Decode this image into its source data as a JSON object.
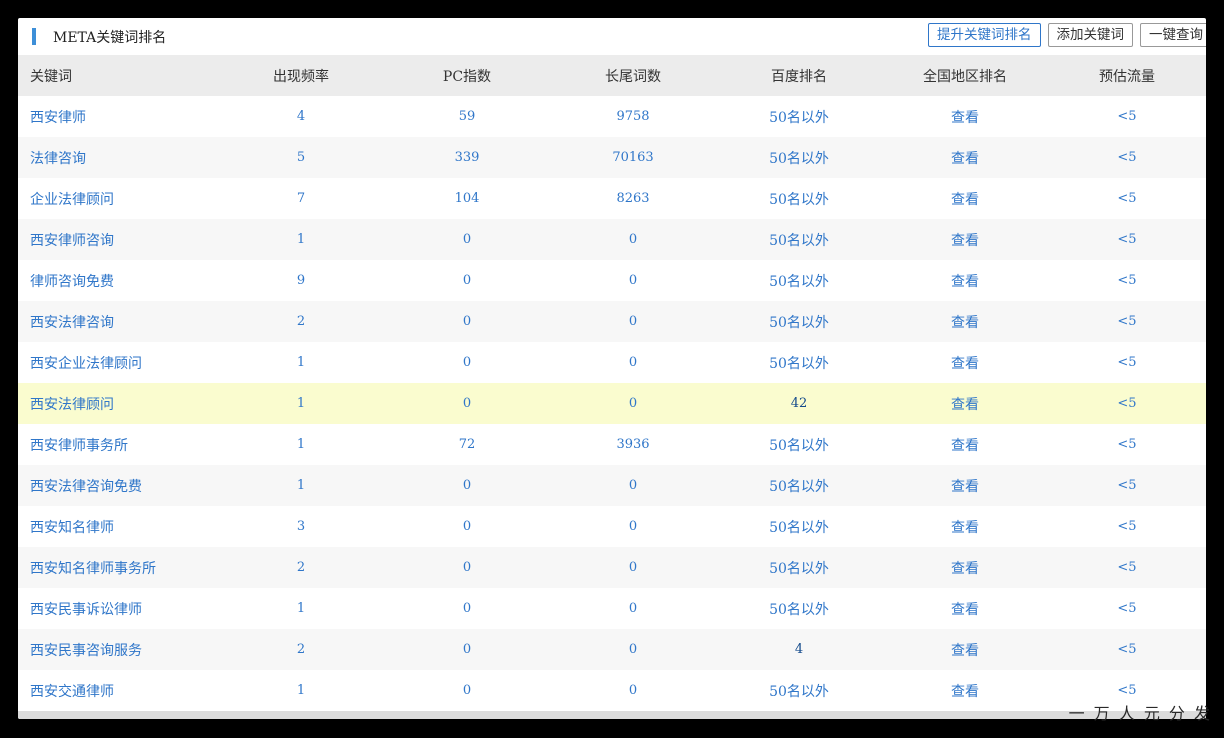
{
  "header": {
    "title": "META关键词排名",
    "buttons": [
      "提升关键词排名",
      "添加关键词",
      "一键查询"
    ]
  },
  "table": {
    "columns": [
      "关键词",
      "出现频率",
      "PC指数",
      "长尾词数",
      "百度排名",
      "全国地区排名",
      "预估流量"
    ],
    "rows": [
      {
        "keyword": "西安律师",
        "freq": "4",
        "pc": "59",
        "tail": "9758",
        "rank": "50名以外",
        "region": "查看",
        "traffic": "<5"
      },
      {
        "keyword": "法律咨询",
        "freq": "5",
        "pc": "339",
        "tail": "70163",
        "rank": "50名以外",
        "region": "查看",
        "traffic": "<5"
      },
      {
        "keyword": "企业法律顾问",
        "freq": "7",
        "pc": "104",
        "tail": "8263",
        "rank": "50名以外",
        "region": "查看",
        "traffic": "<5"
      },
      {
        "keyword": "西安律师咨询",
        "freq": "1",
        "pc": "0",
        "tail": "0",
        "rank": "50名以外",
        "region": "查看",
        "traffic": "<5"
      },
      {
        "keyword": "律师咨询免费",
        "freq": "9",
        "pc": "0",
        "tail": "0",
        "rank": "50名以外",
        "region": "查看",
        "traffic": "<5"
      },
      {
        "keyword": "西安法律咨询",
        "freq": "2",
        "pc": "0",
        "tail": "0",
        "rank": "50名以外",
        "region": "查看",
        "traffic": "<5"
      },
      {
        "keyword": "西安企业法律顾问",
        "freq": "1",
        "pc": "0",
        "tail": "0",
        "rank": "50名以外",
        "region": "查看",
        "traffic": "<5"
      },
      {
        "keyword": "西安法律顾问",
        "freq": "1",
        "pc": "0",
        "tail": "0",
        "rank": "42",
        "region": "查看",
        "traffic": "<5"
      },
      {
        "keyword": "西安律师事务所",
        "freq": "1",
        "pc": "72",
        "tail": "3936",
        "rank": "50名以外",
        "region": "查看",
        "traffic": "<5"
      },
      {
        "keyword": "西安法律咨询免费",
        "freq": "1",
        "pc": "0",
        "tail": "0",
        "rank": "50名以外",
        "region": "查看",
        "traffic": "<5"
      },
      {
        "keyword": "西安知名律师",
        "freq": "3",
        "pc": "0",
        "tail": "0",
        "rank": "50名以外",
        "region": "查看",
        "traffic": "<5"
      },
      {
        "keyword": "西安知名律师事务所",
        "freq": "2",
        "pc": "0",
        "tail": "0",
        "rank": "50名以外",
        "region": "查看",
        "traffic": "<5"
      },
      {
        "keyword": "西安民事诉讼律师",
        "freq": "1",
        "pc": "0",
        "tail": "0",
        "rank": "50名以外",
        "region": "查看",
        "traffic": "<5"
      },
      {
        "keyword": "西安民事咨询服务",
        "freq": "2",
        "pc": "0",
        "tail": "0",
        "rank": "4",
        "region": "查看",
        "traffic": "<5"
      },
      {
        "keyword": "西安交通律师",
        "freq": "1",
        "pc": "0",
        "tail": "0",
        "rank": "50名以外",
        "region": "查看",
        "traffic": "<5"
      }
    ],
    "highlighted_row": 7
  },
  "watermark": "一 万 人 元 分 发"
}
